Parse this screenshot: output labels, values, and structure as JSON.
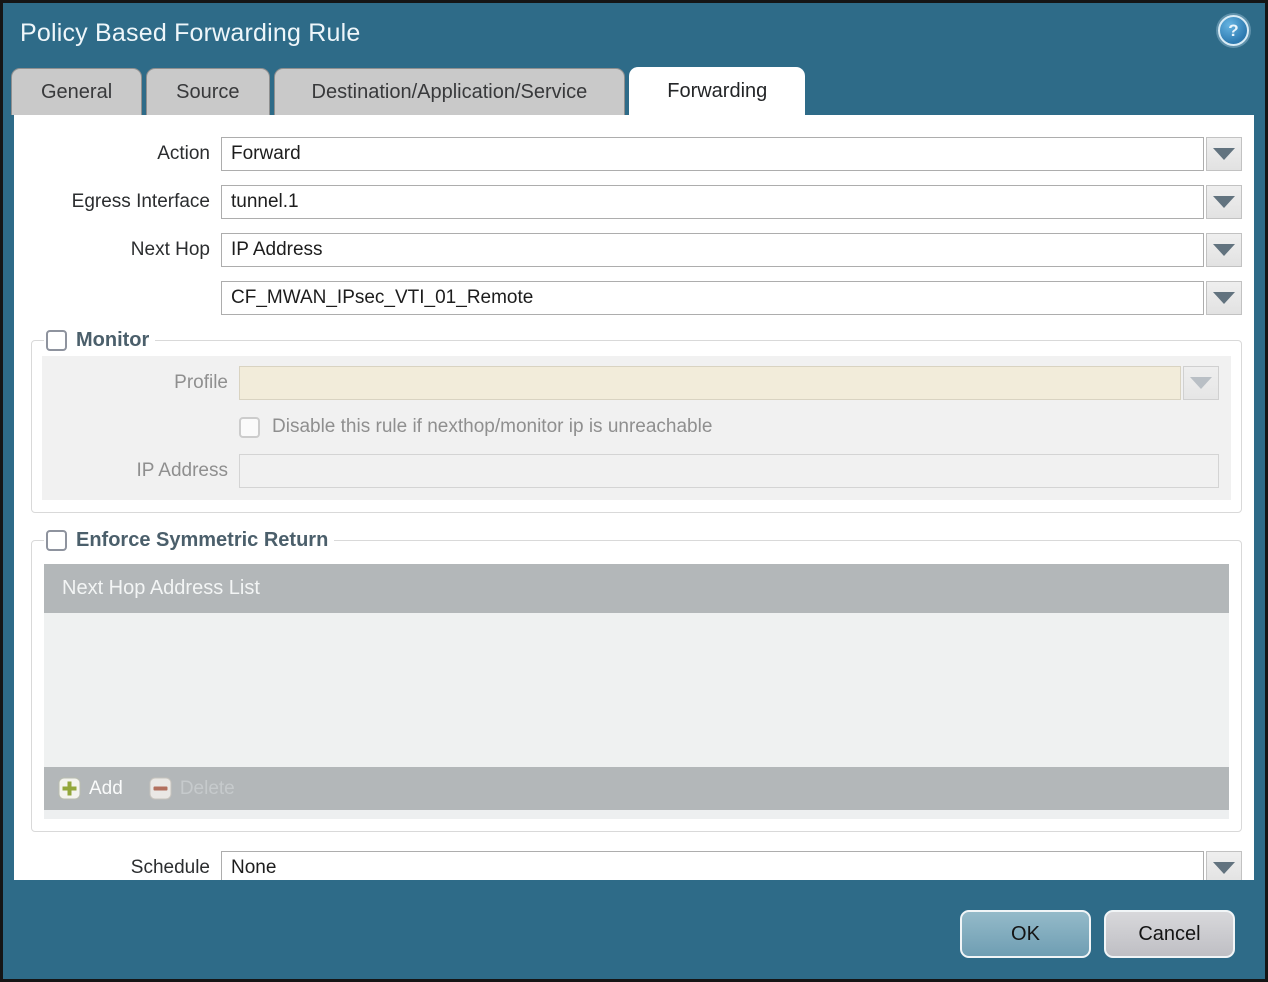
{
  "dialog": {
    "title": "Policy Based Forwarding Rule",
    "help_glyph": "?"
  },
  "tabs": [
    {
      "label": "General",
      "active": false
    },
    {
      "label": "Source",
      "active": false
    },
    {
      "label": "Destination/Application/Service",
      "active": false
    },
    {
      "label": "Forwarding",
      "active": true
    }
  ],
  "form": {
    "action": {
      "label": "Action",
      "value": "Forward"
    },
    "egress_interface": {
      "label": "Egress Interface",
      "value": "tunnel.1"
    },
    "next_hop": {
      "label": "Next Hop",
      "value": "IP Address"
    },
    "next_hop_address": {
      "value": "CF_MWAN_IPsec_VTI_01_Remote"
    },
    "schedule": {
      "label": "Schedule",
      "value": "None"
    }
  },
  "monitor": {
    "label": "Monitor",
    "checked": false,
    "profile": {
      "label": "Profile",
      "value": ""
    },
    "disable_rule": {
      "label": "Disable this rule if nexthop/monitor ip is unreachable",
      "checked": false
    },
    "ip_address": {
      "label": "IP Address",
      "value": ""
    }
  },
  "enforce_symmetric_return": {
    "label": "Enforce Symmetric Return",
    "checked": false,
    "list_header": "Next Hop Address List",
    "rows": [],
    "add_label": "Add",
    "delete_label": "Delete"
  },
  "footer": {
    "ok_label": "OK",
    "cancel_label": "Cancel"
  },
  "colors": {
    "frame_teal": "#2e6b88",
    "inactive_tab": "#c9c9c9",
    "table_header_gray": "#b3b7b9",
    "disabled_field_beige": "#f2ecda",
    "add_icon_green": "#93a73b",
    "delete_icon_red": "#b2705e",
    "ok_button_blue": "#7da9bd"
  }
}
